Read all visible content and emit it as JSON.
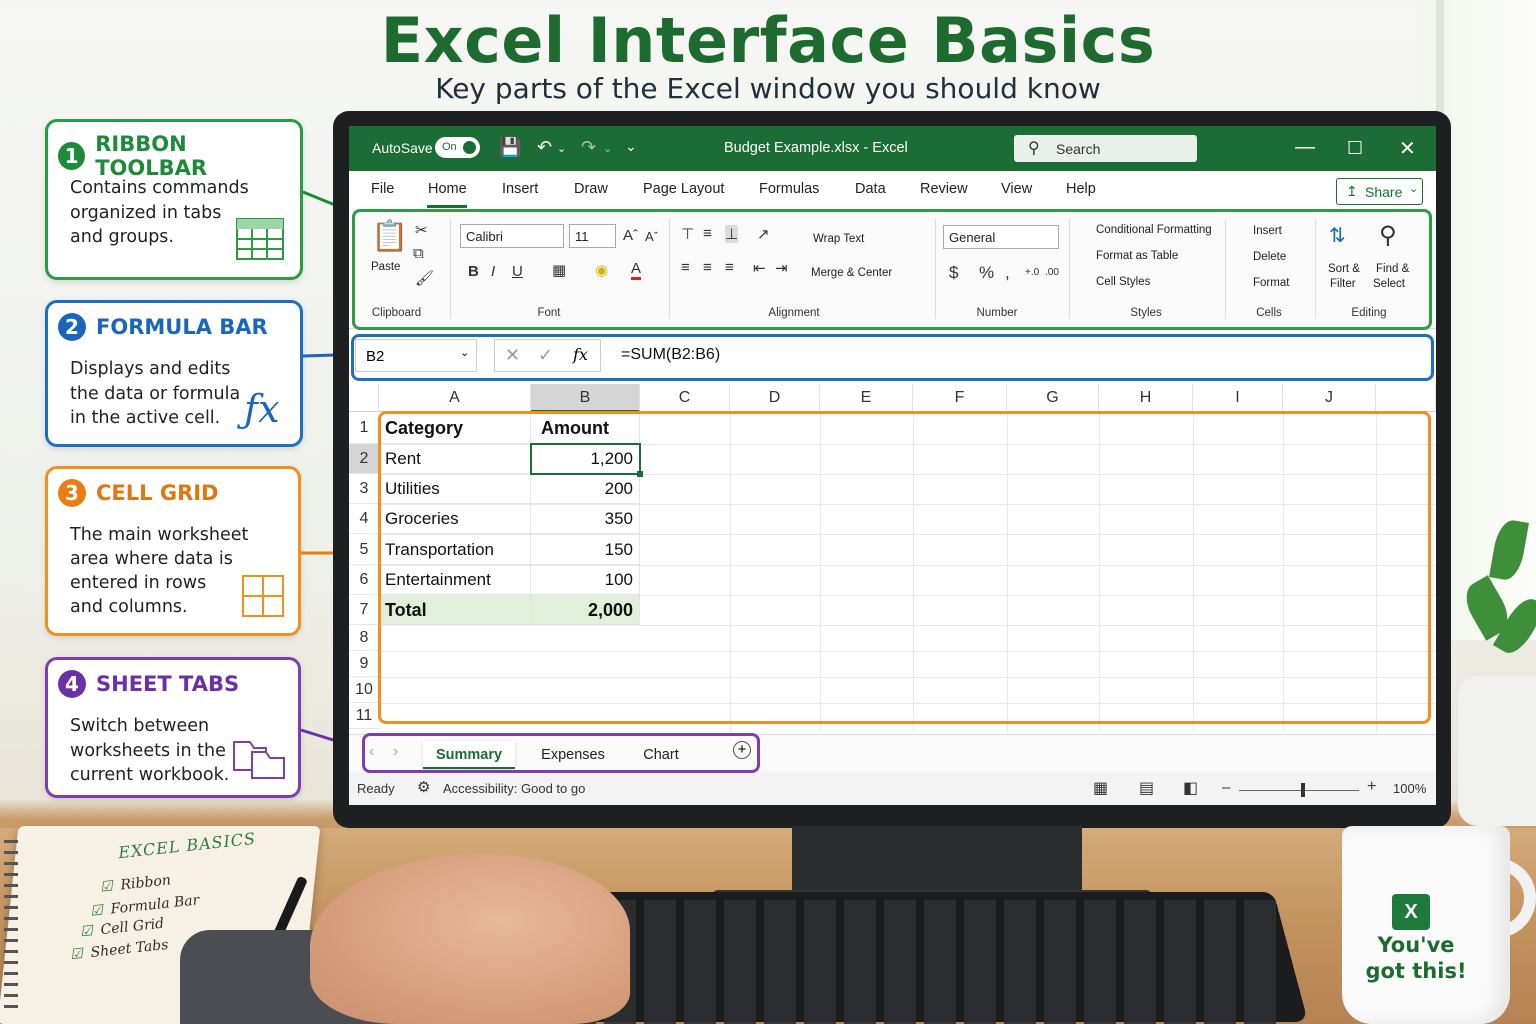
{
  "header": {
    "title": "Excel Interface Basics",
    "subtitle": "Key parts of the Excel window you should know"
  },
  "callouts": [
    {
      "number": "1",
      "title": "RIBBON TOOLBAR",
      "lines": [
        "Contains commands",
        "organized in tabs",
        "and groups."
      ],
      "icon": "table-icon",
      "color": "#1f8a3b"
    },
    {
      "number": "2",
      "title": "FORMULA BAR",
      "lines": [
        "Displays and edits",
        "the data or formula",
        "in the active cell."
      ],
      "icon": "fx-icon",
      "color": "#1a66bd"
    },
    {
      "number": "3",
      "title": "CELL GRID",
      "lines": [
        "The main worksheet",
        "area where data is",
        "entered in rows",
        "and columns."
      ],
      "icon": "grid-icon",
      "color": "#e37610"
    },
    {
      "number": "4",
      "title": "SHEET TABS",
      "lines": [
        "Switch between",
        "worksheets in the",
        "current workbook."
      ],
      "icon": "sheets-icon",
      "color": "#6c30a6"
    }
  ],
  "excel": {
    "titlebar": {
      "autosave_label": "AutoSave",
      "autosave_state": "On",
      "filename": "Budget Example.xlsx  -  Excel",
      "search_placeholder": "Search"
    },
    "menu": [
      "File",
      "Home",
      "Insert",
      "Draw",
      "Page Layout",
      "Formulas",
      "Data",
      "Review",
      "View",
      "Help"
    ],
    "active_menu": "Home",
    "share_label": "Share",
    "ribbon": {
      "clipboard": {
        "paste": "Paste",
        "label": "Clipboard"
      },
      "font": {
        "name": "Calibri",
        "size": "11",
        "label": "Font"
      },
      "alignment": {
        "wrap": "Wrap Text",
        "merge": "Merge & Center",
        "label": "Alignment"
      },
      "number": {
        "format": "General",
        "label": "Number"
      },
      "styles": {
        "conditional": "Conditional Formatting",
        "table": "Format as Table",
        "cell": "Cell Styles",
        "label": "Styles"
      },
      "cells": {
        "insert": "Insert",
        "delete": "Delete",
        "format": "Format",
        "label": "Cells"
      },
      "editing": {
        "sort": "Sort &",
        "sort2": "Filter",
        "find": "Find &",
        "find2": "Select",
        "label": "Editing"
      }
    },
    "formula_bar": {
      "name_box": "B2",
      "fx": "fx",
      "formula": "=SUM(B2:B6)"
    },
    "columns": [
      "A",
      "B",
      "C",
      "D",
      "E",
      "F",
      "G",
      "H",
      "I",
      "J"
    ],
    "rows": [
      "1",
      "2",
      "3",
      "4",
      "5",
      "6",
      "7",
      "8",
      "9",
      "10",
      "11"
    ],
    "table": {
      "headers": [
        "Category",
        "Amount"
      ],
      "rows": [
        [
          "Rent",
          "1,200"
        ],
        [
          "Utilities",
          "200"
        ],
        [
          "Groceries",
          "350"
        ],
        [
          "Transportation",
          "150"
        ],
        [
          "Entertainment",
          "100"
        ]
      ],
      "total": [
        "Total",
        "2,000"
      ]
    },
    "sheets": [
      "Summary",
      "Expenses",
      "Chart"
    ],
    "active_sheet": "Summary",
    "status": {
      "ready": "Ready",
      "accessibility": "Accessibility: Good to go",
      "zoom": "100%"
    }
  },
  "notebook": {
    "title": "EXCEL BASICS",
    "items": [
      "Ribbon",
      "Formula Bar",
      "Cell Grid",
      "Sheet Tabs"
    ]
  },
  "mug": {
    "logo": "X",
    "line1": "You've",
    "line2": "got this!"
  }
}
